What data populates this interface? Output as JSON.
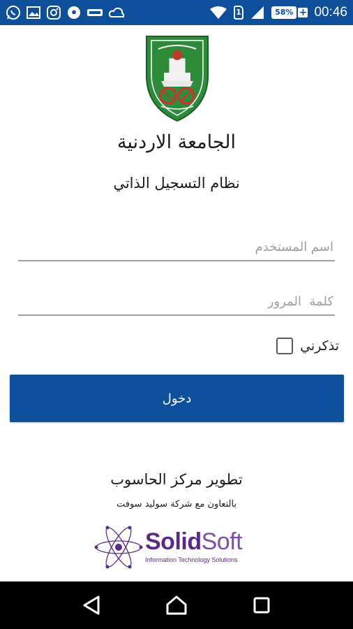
{
  "status_bar": {
    "battery_level": "58%",
    "sim_slot": "1",
    "time": "00:46",
    "icons": [
      "whatsapp-icon",
      "gallery-icon",
      "instagram-icon",
      "soccer-icon",
      "data-icon",
      "cloud-icon",
      "wifi-icon",
      "sim-icon",
      "signal-icon",
      "battery-icon"
    ]
  },
  "header": {
    "university_name": "الجامعة الاردنية",
    "system_name": "نظام التسجيل الذاتي"
  },
  "form": {
    "username_placeholder": "اسم المستخدم",
    "password_placeholder": "كلمة  المرور",
    "remember_label": "تذكرني",
    "remember_checked": false,
    "login_label": "دخول"
  },
  "footer": {
    "developed_by": "تطوير مركز الحاسوب",
    "cooperation": "بالتعاون مع شركة سوليد سوفت",
    "partner_word_1": "Solid",
    "partner_word_2": "Soft",
    "partner_tagline": "Information Technology Solutions"
  },
  "colors": {
    "primary": "#0d4f9b",
    "partner": "#5b2a86",
    "logo_green": "#2e8b3a"
  },
  "nav_bar": {
    "buttons": [
      "back-icon",
      "home-icon",
      "recents-icon"
    ]
  }
}
